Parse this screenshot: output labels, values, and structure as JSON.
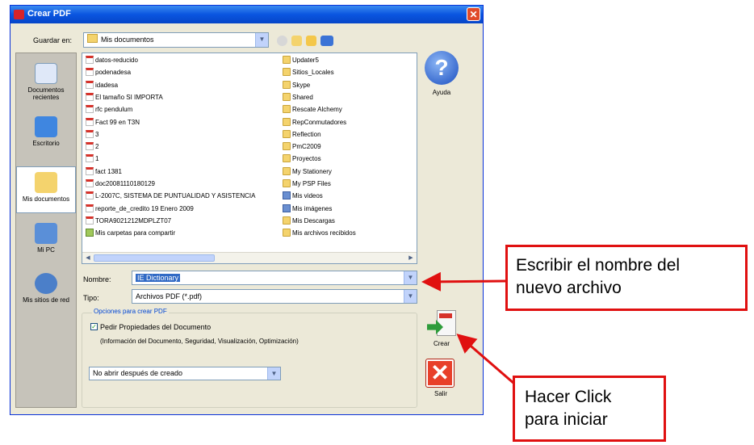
{
  "window": {
    "title": "Crear PDF",
    "close_glyph": "✕"
  },
  "toolbar": {
    "save_in_label": "Guardar en:",
    "location": "Mis documentos",
    "icons": [
      "back-icon",
      "up-folder-icon",
      "new-folder-icon",
      "view-menu-icon"
    ]
  },
  "places": [
    {
      "label": "Documentos recientes",
      "icon": "recent-documents-icon",
      "selected": false
    },
    {
      "label": "Escritorio",
      "icon": "desktop-icon",
      "selected": false
    },
    {
      "label": "Mis documentos",
      "icon": "my-documents-icon",
      "selected": true
    },
    {
      "label": "Mi PC",
      "icon": "my-computer-icon",
      "selected": false
    },
    {
      "label": "Mis sitios de red",
      "icon": "network-places-icon",
      "selected": false
    }
  ],
  "files_col1": [
    {
      "name": "datos-reducido",
      "type": "pdf"
    },
    {
      "name": "podenadesa",
      "type": "pdf"
    },
    {
      "name": "idadesa",
      "type": "pdf"
    },
    {
      "name": "El tamaño SI IMPORTA",
      "type": "pdf"
    },
    {
      "name": "rfc pendulum",
      "type": "pdf"
    },
    {
      "name": "Fact 99 en T3N",
      "type": "pdf"
    },
    {
      "name": "3",
      "type": "pdf"
    },
    {
      "name": "2",
      "type": "pdf"
    },
    {
      "name": "1",
      "type": "pdf"
    },
    {
      "name": "fact 1381",
      "type": "pdf"
    },
    {
      "name": "doc20081110180129",
      "type": "pdf"
    },
    {
      "name": "L-2007C, SISTEMA DE PUNTUALIDAD Y ASISTENCIA",
      "type": "pdf"
    },
    {
      "name": "reporte_de_credito 19 Enero 2009",
      "type": "pdf"
    },
    {
      "name": "TORA9021212MDPLZT07",
      "type": "pdf"
    },
    {
      "name": "Mis carpetas para compartir",
      "type": "share"
    }
  ],
  "files_col2": [
    {
      "name": "Updater5",
      "type": "folder"
    },
    {
      "name": "Sitios_Locales",
      "type": "folder"
    },
    {
      "name": "Skype",
      "type": "folder"
    },
    {
      "name": "Shared",
      "type": "folder"
    },
    {
      "name": "Rescate Alchemy",
      "type": "folder"
    },
    {
      "name": "RepConmutadores",
      "type": "folder"
    },
    {
      "name": "Reflection",
      "type": "folder"
    },
    {
      "name": "PmC2009",
      "type": "folder"
    },
    {
      "name": "Proyectos",
      "type": "folder"
    },
    {
      "name": "My Stationery",
      "type": "folder"
    },
    {
      "name": "My PSP Files",
      "type": "folder"
    },
    {
      "name": "Mis videos",
      "type": "special"
    },
    {
      "name": "Mis imágenes",
      "type": "special"
    },
    {
      "name": "Mis Descargas",
      "type": "folder"
    },
    {
      "name": "Mis archivos recibidos",
      "type": "folder"
    }
  ],
  "fields": {
    "name_label": "Nombre:",
    "name_value": "IE Dictionary",
    "type_label": "Tipo:",
    "type_value": "Archivos PDF (*.pdf)"
  },
  "options": {
    "group_title": "Opciones para crear PDF",
    "checkbox_label": "Pedir Propiedades del Documento",
    "checkbox_checked": true,
    "checkbox_mark": "✓",
    "description": "(Información del Documento, Seguridad, Visualización, Optimización)",
    "after_create": "No abrir después de creado"
  },
  "buttons": {
    "help_label": "Ayuda",
    "help_glyph": "?",
    "create_label": "Crear",
    "exit_label": "Salir",
    "exit_glyph": "✕"
  },
  "callouts": {
    "name_callout": [
      "Escribir el nombre del",
      "nuevo archivo"
    ],
    "click_callout": [
      "Hacer Click",
      "para iniciar"
    ]
  },
  "colors": {
    "callout_border": "#e01010",
    "titlebar": "#0a55e0",
    "dialog_bg": "#ece9d8"
  }
}
